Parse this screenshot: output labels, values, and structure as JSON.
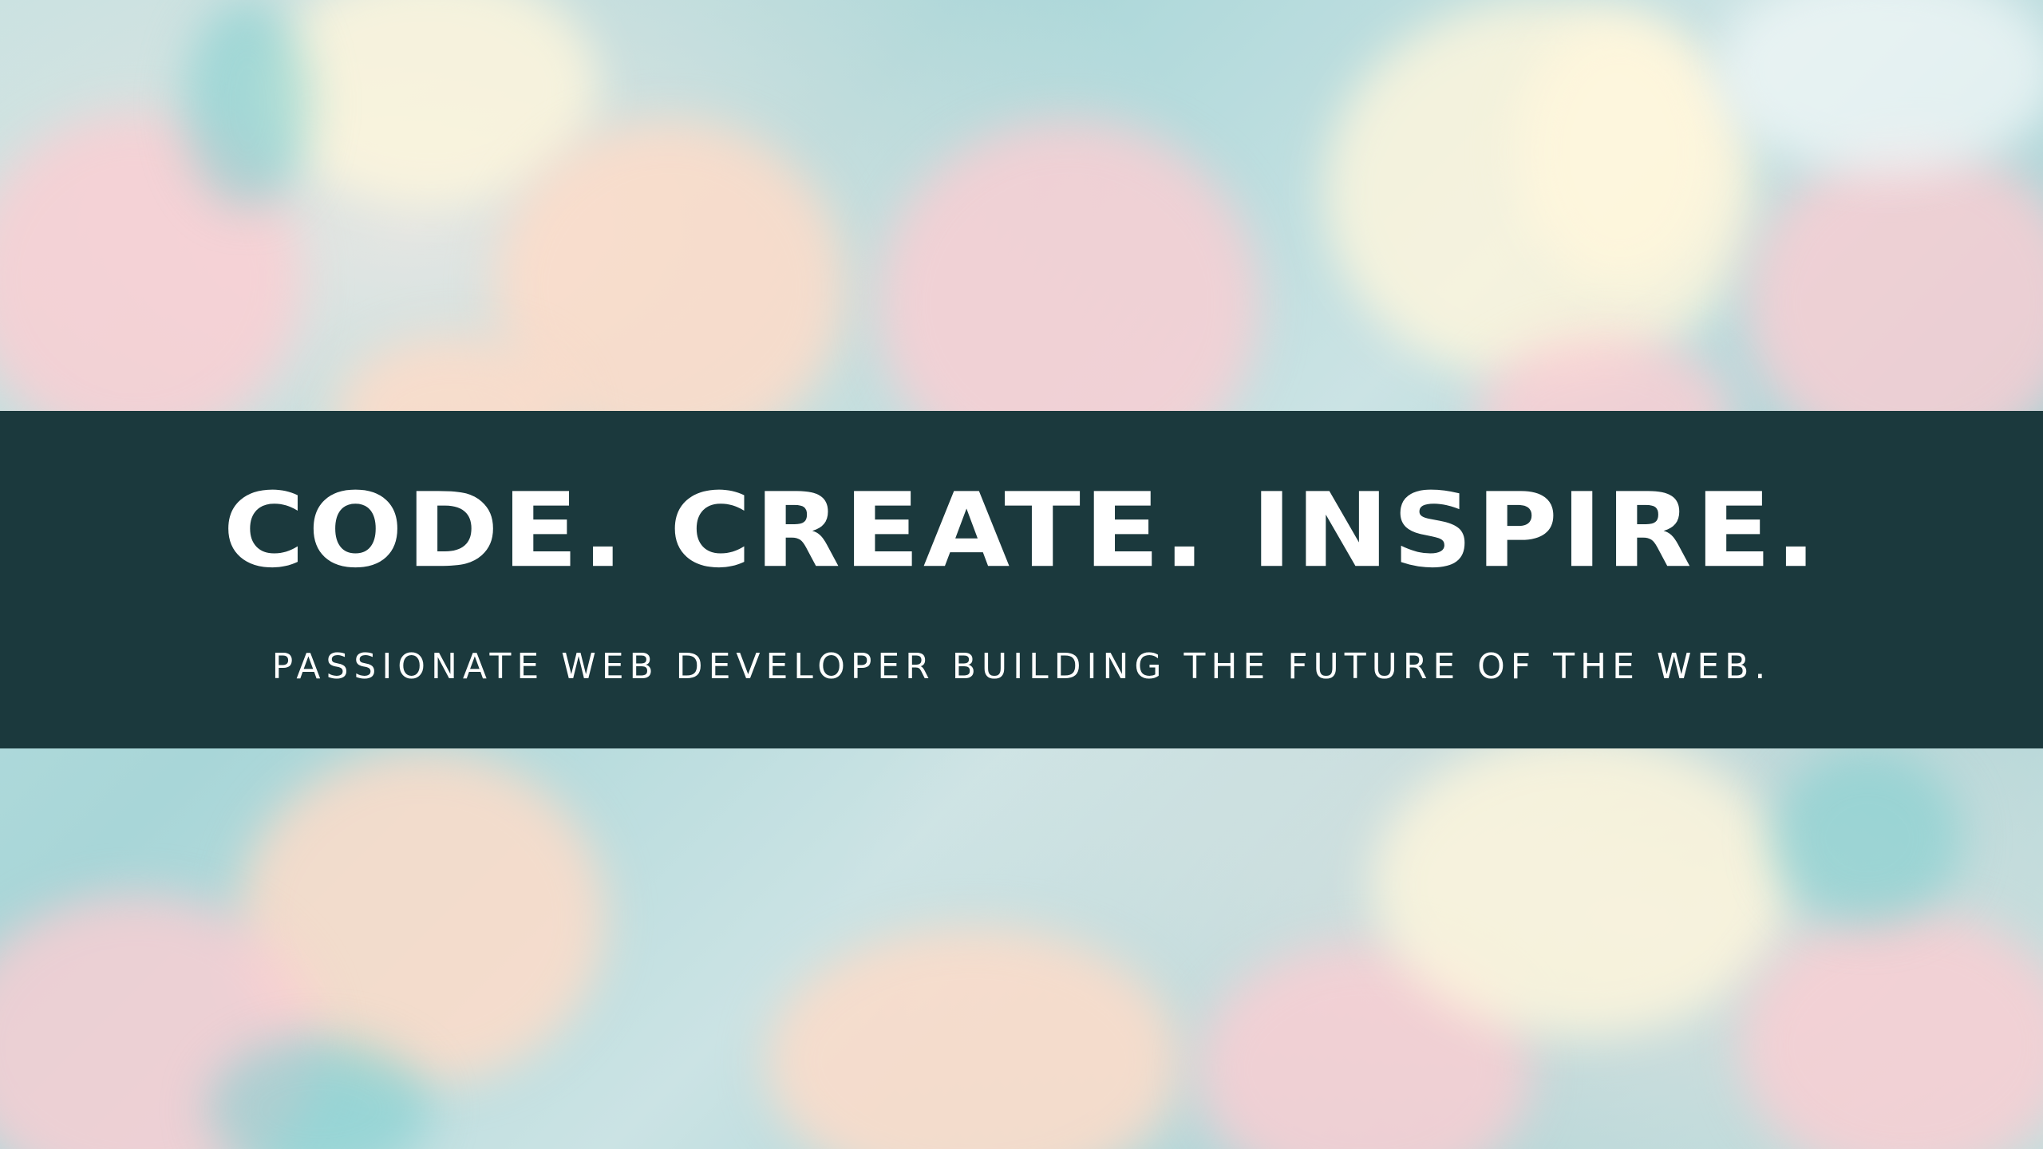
{
  "hero": {
    "headline": "CODE. CREATE. INSPIRE.",
    "tagline": "PASSIONATE WEB DEVELOPER BUILDING THE FUTURE OF THE WEB."
  },
  "colors": {
    "banner": "#1b393d",
    "text": "#ffffff",
    "background": "#a9d3d6"
  }
}
